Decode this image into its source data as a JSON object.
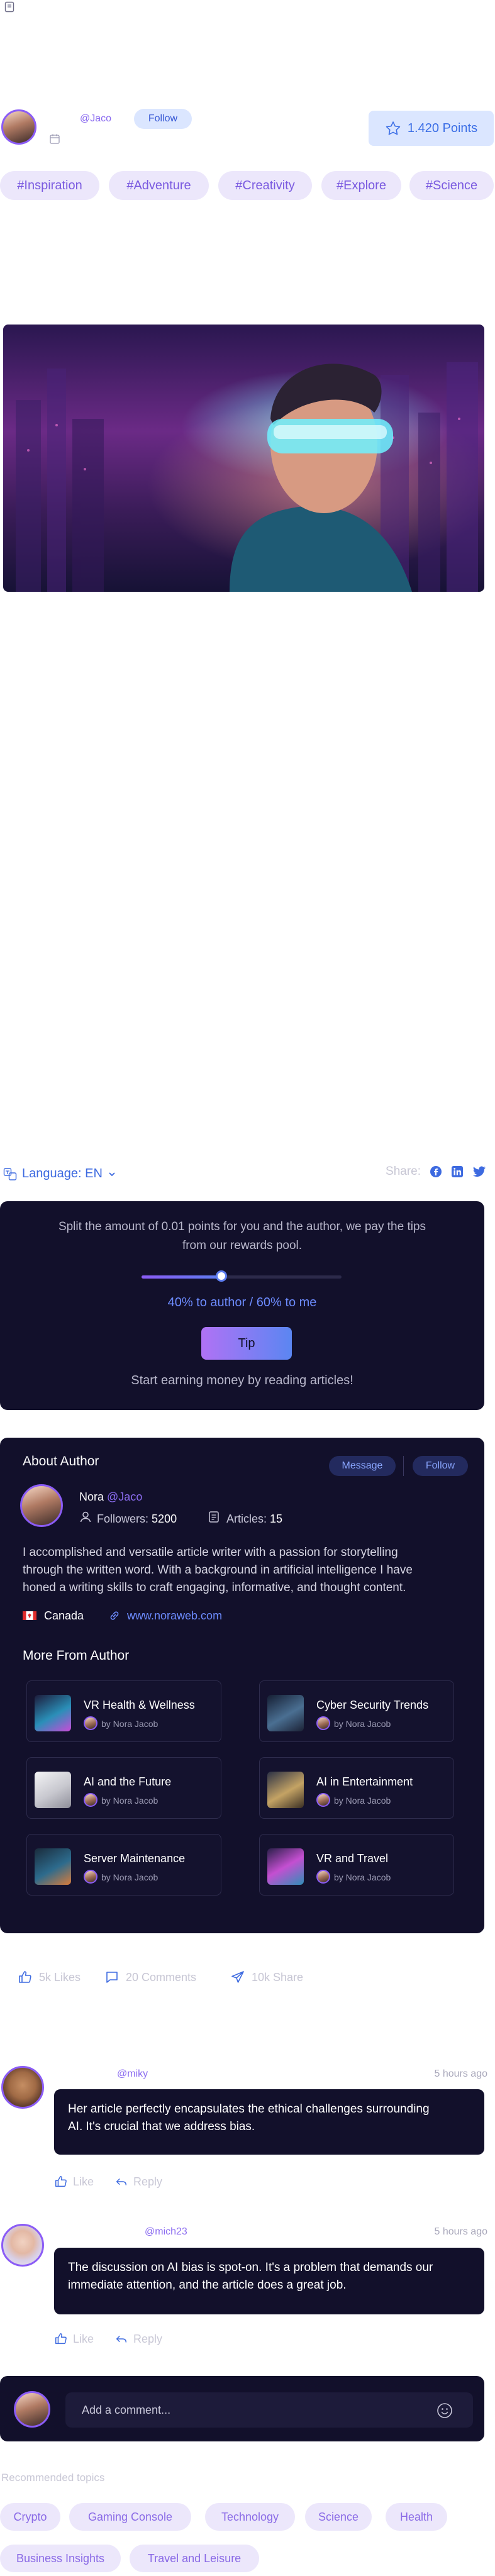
{
  "header": {
    "handle": "@Jaco",
    "follow_label": "Follow",
    "points_label": "1.420 Points",
    "top_icon": "bookmark-icon",
    "date_icon": "calendar-icon"
  },
  "tags": [
    "#Inspiration",
    "#Adventure",
    "#Creativity",
    "#Explore",
    "#Science"
  ],
  "language": {
    "label": "Language: EN"
  },
  "share": {
    "label": "Share:",
    "icons": [
      "facebook-icon",
      "linkedin-icon",
      "twitter-icon"
    ]
  },
  "tip": {
    "text_line1": "Split the amount of 0.01 points for you and the author, we pay the tips",
    "text_line2": "from our rewards pool.",
    "split_label": "40% to author / 60% to me",
    "slider_fraction": 0.4,
    "tip_button": "Tip",
    "footer": "Start earning money by reading articles!"
  },
  "author": {
    "section_title": "About Author",
    "message_button": "Message",
    "follow_button": "Follow",
    "name": "Nora",
    "handle": "@Jaco",
    "followers_label": "Followers:",
    "followers_value": "5200",
    "articles_label": "Articles:",
    "articles_value": "15",
    "bio_line1": "I accomplished and versatile article writer with a passion for storytelling",
    "bio_line2": "through the written word. With a background in artificial intelligence I have",
    "bio_line3": "honed a writing skills to craft engaging, informative, and thought content.",
    "country": "Canada",
    "website": "www.noraweb.com",
    "more_title": "More From Author",
    "articles": [
      {
        "title": "VR Health & Wellness",
        "by": "by Nora Jacob"
      },
      {
        "title": "Cyber Security Trends",
        "by": "by Nora Jacob"
      },
      {
        "title": "AI and the Future",
        "by": "by Nora Jacob"
      },
      {
        "title": "AI in Entertainment",
        "by": "by Nora Jacob"
      },
      {
        "title": "Server Maintenance",
        "by": "by Nora Jacob"
      },
      {
        "title": "VR and Travel",
        "by": "by Nora Jacob"
      }
    ]
  },
  "reactions": {
    "likes": "5k Likes",
    "comments": "20 Comments",
    "shares": "10k Share"
  },
  "comments": [
    {
      "user": "@miky",
      "time": "5 hours ago",
      "text_line1": "Her article perfectly encapsulates the ethical challenges surrounding",
      "text_line2": "AI. It's crucial that we address bias.",
      "like": "Like",
      "reply": "Reply"
    },
    {
      "user": "@mich23",
      "time": "5 hours ago",
      "text_line1": "The discussion on AI bias is spot-on. It's a problem that demands our",
      "text_line2": "immediate attention, and the article does a great job.",
      "like": "Like",
      "reply": "Reply"
    }
  ],
  "composer": {
    "placeholder": "Add a comment..."
  },
  "recommended": {
    "title": "Recommended topics",
    "topics": [
      "Crypto",
      "Gaming Console",
      "Technology",
      "Science",
      "Health",
      "Business Insights",
      "Travel and Leisure"
    ]
  },
  "colors": {
    "accent": "#3b6ee6",
    "purple": "#8b5cf6",
    "dark_card": "#12102b",
    "tag_bg": "#ece7fb"
  }
}
